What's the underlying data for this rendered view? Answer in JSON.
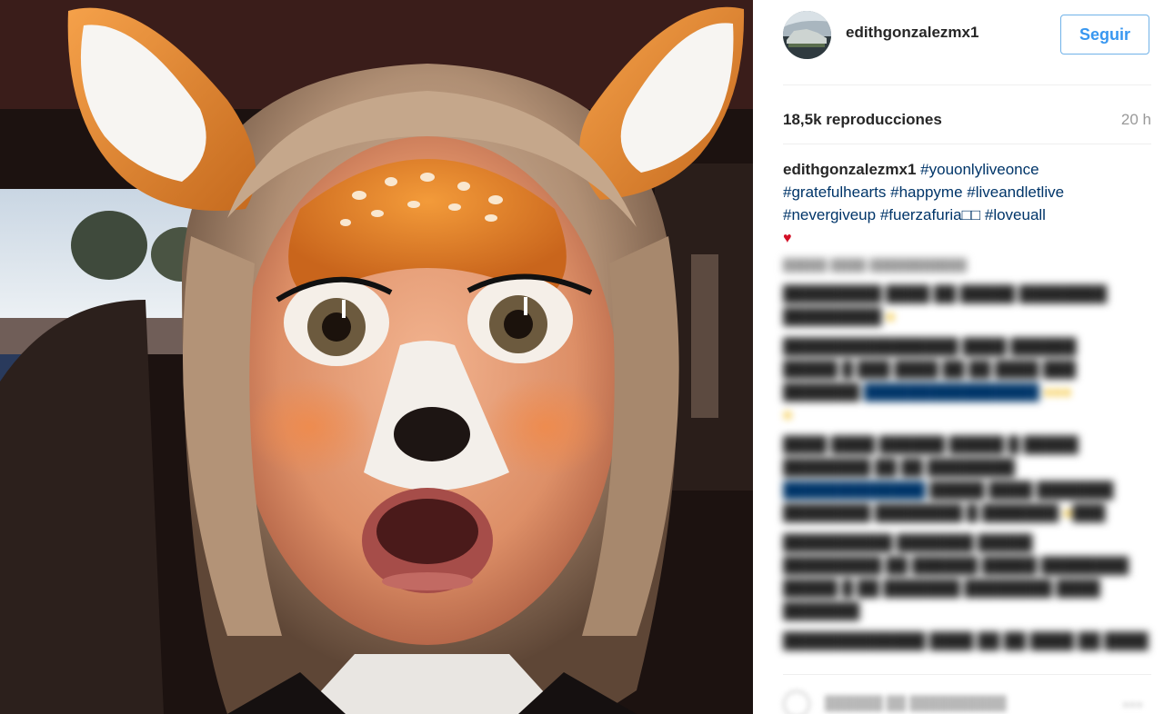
{
  "post": {
    "username": "edithgonzalezmx1",
    "follow_label": "Seguir",
    "views": "18,5k reproducciones",
    "time_ago": "20 h",
    "caption": {
      "username": "edithgonzalezmx1",
      "line1_tag": "#youonlyliveonce",
      "line2_tags": [
        "#gratefulhearts",
        "#happyme",
        "#liveandletlive"
      ],
      "line3_tags": [
        "#nevergiveup",
        "#fuerzafuria□□",
        "#loveuall"
      ],
      "heart": "♥"
    }
  },
  "colors": {
    "link": "#003569",
    "follow_border": "#70b2e8",
    "follow_text": "#3897f0",
    "heart": "#d31027"
  },
  "icons": {
    "avatar": "avatar",
    "comment": "comment-icon"
  }
}
